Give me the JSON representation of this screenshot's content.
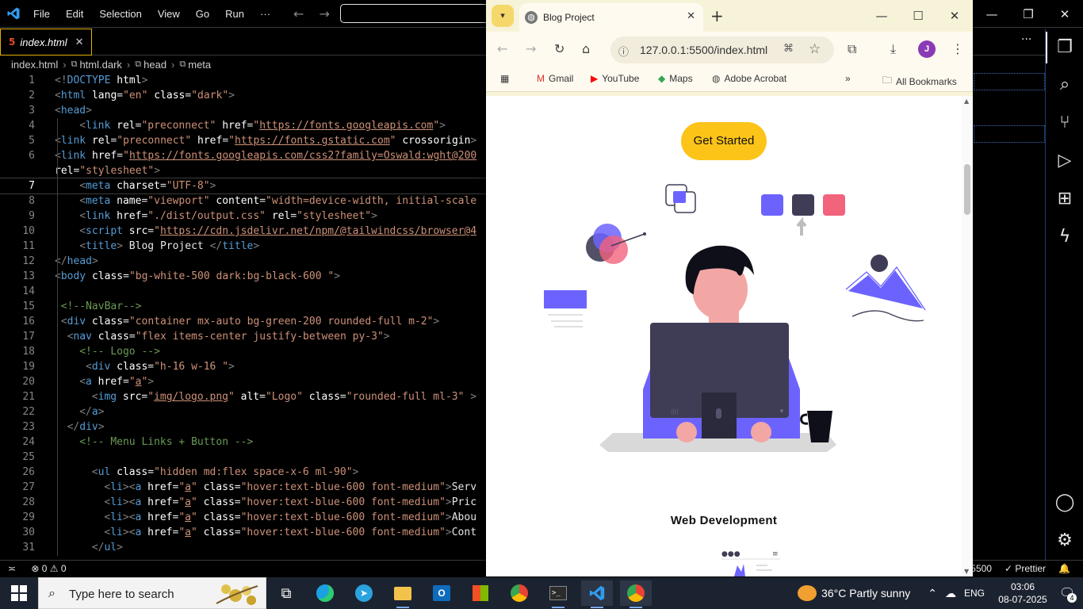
{
  "vscode": {
    "menu": [
      "File",
      "Edit",
      "Selection",
      "View",
      "Go",
      "Run",
      "···"
    ],
    "tab": {
      "label": "index.html",
      "close": "✕"
    },
    "more_actions": "···",
    "breadcrumb": [
      "index.html",
      "html.dark",
      "head",
      "meta"
    ],
    "active_line": 7,
    "lines": [
      {
        "n": "1",
        "indent": 0,
        "parts": [
          [
            "c-tag",
            "<!"
          ],
          [
            "c-name",
            "DOCTYPE"
          ],
          [
            "c-attr",
            " html"
          ],
          [
            "c-tag",
            ">"
          ]
        ]
      },
      {
        "n": "2",
        "indent": 0,
        "parts": [
          [
            "c-tag",
            "<"
          ],
          [
            "c-name",
            "html"
          ],
          [
            "c-attr",
            " lang"
          ],
          [
            "",
            "="
          ],
          [
            "c-str",
            "\"en\""
          ],
          [
            "c-attr",
            " class"
          ],
          [
            "",
            "="
          ],
          [
            "c-str",
            "\"dark\""
          ],
          [
            "c-tag",
            ">"
          ]
        ]
      },
      {
        "n": "3",
        "indent": 0,
        "parts": [
          [
            "c-tag",
            "<"
          ],
          [
            "c-name",
            "head"
          ],
          [
            "c-tag",
            ">"
          ]
        ]
      },
      {
        "n": "4",
        "indent": 4,
        "parts": [
          [
            "c-tag",
            "<"
          ],
          [
            "c-name",
            "link"
          ],
          [
            "c-attr",
            " rel"
          ],
          [
            "",
            "="
          ],
          [
            "c-str",
            "\"preconnect\""
          ],
          [
            "c-attr",
            " href"
          ],
          [
            "",
            "="
          ],
          [
            "c-str",
            "\""
          ],
          [
            "c-url",
            "https://fonts.googleapis.com"
          ],
          [
            "c-str",
            "\""
          ],
          [
            "c-tag",
            ">"
          ]
        ]
      },
      {
        "n": "5",
        "indent": 0,
        "parts": [
          [
            "c-tag",
            "<"
          ],
          [
            "c-name",
            "link"
          ],
          [
            "c-attr",
            " rel"
          ],
          [
            "",
            "="
          ],
          [
            "c-str",
            "\"preconnect\""
          ],
          [
            "c-attr",
            " href"
          ],
          [
            "",
            "="
          ],
          [
            "c-str",
            "\""
          ],
          [
            "c-url",
            "https://fonts.gstatic.com"
          ],
          [
            "c-str",
            "\""
          ],
          [
            "c-attr",
            " crossorigin"
          ],
          [
            "c-tag",
            ">"
          ]
        ]
      },
      {
        "n": "6",
        "indent": 0,
        "parts": [
          [
            "c-tag",
            "<"
          ],
          [
            "c-name",
            "link"
          ],
          [
            "c-attr",
            " href"
          ],
          [
            "",
            "="
          ],
          [
            "c-str",
            "\""
          ],
          [
            "c-url",
            "https://fonts.googleapis.com/css2?family=Oswald:wght@200"
          ]
        ]
      },
      {
        "n": "",
        "indent": 0,
        "parts": [
          [
            "c-attr",
            "rel"
          ],
          [
            "",
            "="
          ],
          [
            "c-str",
            "\"stylesheet\""
          ],
          [
            "c-tag",
            ">"
          ]
        ]
      },
      {
        "n": "7",
        "indent": 4,
        "parts": [
          [
            "c-tag",
            "<"
          ],
          [
            "c-name",
            "meta"
          ],
          [
            "c-attr",
            " charset"
          ],
          [
            "",
            "="
          ],
          [
            "c-str",
            "\"UTF-8\""
          ],
          [
            "c-tag",
            ">"
          ]
        ]
      },
      {
        "n": "8",
        "indent": 4,
        "parts": [
          [
            "c-tag",
            "<"
          ],
          [
            "c-name",
            "meta"
          ],
          [
            "c-attr",
            " name"
          ],
          [
            "",
            "="
          ],
          [
            "c-str",
            "\"viewport\""
          ],
          [
            "c-attr",
            " content"
          ],
          [
            "",
            "="
          ],
          [
            "c-str",
            "\"width=device-width, initial-scale"
          ]
        ]
      },
      {
        "n": "9",
        "indent": 4,
        "parts": [
          [
            "c-tag",
            "<"
          ],
          [
            "c-name",
            "link"
          ],
          [
            "c-attr",
            " href"
          ],
          [
            "",
            "="
          ],
          [
            "c-str",
            "\"./dist/output.css\""
          ],
          [
            "c-attr",
            " rel"
          ],
          [
            "",
            "="
          ],
          [
            "c-str",
            "\"stylesheet\""
          ],
          [
            "c-tag",
            ">"
          ]
        ]
      },
      {
        "n": "10",
        "indent": 4,
        "parts": [
          [
            "c-tag",
            "<"
          ],
          [
            "c-name",
            "script"
          ],
          [
            "c-attr",
            " src"
          ],
          [
            "",
            "="
          ],
          [
            "c-str",
            "\""
          ],
          [
            "c-url",
            "https://cdn.jsdelivr.net/npm/@tailwindcss/browser@4"
          ]
        ]
      },
      {
        "n": "11",
        "indent": 4,
        "parts": [
          [
            "c-tag",
            "<"
          ],
          [
            "c-name",
            "title"
          ],
          [
            "c-tag",
            ">"
          ],
          [
            "",
            " Blog Project "
          ],
          [
            "c-tag",
            "</"
          ],
          [
            "c-name",
            "title"
          ],
          [
            "c-tag",
            ">"
          ]
        ]
      },
      {
        "n": "12",
        "indent": 0,
        "parts": [
          [
            "c-tag",
            "</"
          ],
          [
            "c-name",
            "head"
          ],
          [
            "c-tag",
            ">"
          ]
        ]
      },
      {
        "n": "13",
        "indent": 0,
        "parts": [
          [
            "c-tag",
            "<"
          ],
          [
            "c-name",
            "body"
          ],
          [
            "c-attr",
            " class"
          ],
          [
            "",
            "="
          ],
          [
            "c-str",
            "\"bg-white-500 dark:bg-black-600 \""
          ],
          [
            "c-tag",
            ">"
          ]
        ]
      },
      {
        "n": "14",
        "indent": 0,
        "parts": []
      },
      {
        "n": "15",
        "indent": 1,
        "parts": [
          [
            "c-com",
            "<!--NavBar-->"
          ]
        ]
      },
      {
        "n": "16",
        "indent": 1,
        "parts": [
          [
            "c-tag",
            "<"
          ],
          [
            "c-name",
            "div"
          ],
          [
            "c-attr",
            " class"
          ],
          [
            "",
            "="
          ],
          [
            "c-str",
            "\"container mx-auto bg-green-200 rounded-full m-2\""
          ],
          [
            "c-tag",
            ">"
          ]
        ]
      },
      {
        "n": "17",
        "indent": 2,
        "parts": [
          [
            "c-tag",
            "<"
          ],
          [
            "c-name",
            "nav"
          ],
          [
            "c-attr",
            " class"
          ],
          [
            "",
            "="
          ],
          [
            "c-str",
            "\"flex items-center justify-between py-3\""
          ],
          [
            "c-tag",
            ">"
          ]
        ]
      },
      {
        "n": "18",
        "indent": 4,
        "parts": [
          [
            "c-com",
            "<!-- Logo -->"
          ]
        ]
      },
      {
        "n": "19",
        "indent": 5,
        "parts": [
          [
            "c-tag",
            "<"
          ],
          [
            "c-name",
            "div"
          ],
          [
            "c-attr",
            " class"
          ],
          [
            "",
            "="
          ],
          [
            "c-str",
            "\"h-16 w-16 \""
          ],
          [
            "c-tag",
            ">"
          ]
        ]
      },
      {
        "n": "20",
        "indent": 4,
        "parts": [
          [
            "c-tag",
            "<"
          ],
          [
            "c-name",
            "a"
          ],
          [
            "c-attr",
            " href"
          ],
          [
            "",
            "="
          ],
          [
            "c-str",
            "\""
          ],
          [
            "c-url",
            "a"
          ],
          [
            "c-str",
            "\""
          ],
          [
            "c-tag",
            ">"
          ]
        ]
      },
      {
        "n": "21",
        "indent": 6,
        "parts": [
          [
            "c-tag",
            "<"
          ],
          [
            "c-name",
            "img"
          ],
          [
            "c-attr",
            " src"
          ],
          [
            "",
            "="
          ],
          [
            "c-str",
            "\""
          ],
          [
            "c-url",
            "img/logo.png"
          ],
          [
            "c-str",
            "\""
          ],
          [
            "c-attr",
            " alt"
          ],
          [
            "",
            "="
          ],
          [
            "c-str",
            "\"Logo\""
          ],
          [
            "c-attr",
            " class"
          ],
          [
            "",
            "="
          ],
          [
            "c-str",
            "\"rounded-full ml-3\""
          ],
          [
            "c-tag",
            " >"
          ]
        ]
      },
      {
        "n": "22",
        "indent": 4,
        "parts": [
          [
            "c-tag",
            "</"
          ],
          [
            "c-name",
            "a"
          ],
          [
            "c-tag",
            ">"
          ]
        ]
      },
      {
        "n": "23",
        "indent": 2,
        "parts": [
          [
            "c-tag",
            "</"
          ],
          [
            "c-name",
            "div"
          ],
          [
            "c-tag",
            ">"
          ]
        ]
      },
      {
        "n": "24",
        "indent": 4,
        "parts": [
          [
            "c-com",
            "<!-- Menu Links + Button -->"
          ]
        ]
      },
      {
        "n": "25",
        "indent": 0,
        "parts": []
      },
      {
        "n": "26",
        "indent": 6,
        "parts": [
          [
            "c-tag",
            "<"
          ],
          [
            "c-name",
            "ul"
          ],
          [
            "c-attr",
            " class"
          ],
          [
            "",
            "="
          ],
          [
            "c-str",
            "\"hidden md:flex space-x-6 ml-90\""
          ],
          [
            "c-tag",
            ">"
          ]
        ]
      },
      {
        "n": "27",
        "indent": 8,
        "parts": [
          [
            "c-tag",
            "<"
          ],
          [
            "c-name",
            "li"
          ],
          [
            "c-tag",
            ">"
          ],
          [
            "c-tag",
            "<"
          ],
          [
            "c-name",
            "a"
          ],
          [
            "c-attr",
            " href"
          ],
          [
            "",
            "="
          ],
          [
            "c-str",
            "\""
          ],
          [
            "c-url",
            "a"
          ],
          [
            "c-str",
            "\""
          ],
          [
            "c-attr",
            " class"
          ],
          [
            "",
            "="
          ],
          [
            "c-str",
            "\"hover:text-blue-600 font-medium\""
          ],
          [
            "c-tag",
            ">"
          ],
          [
            "",
            "Serv"
          ]
        ]
      },
      {
        "n": "28",
        "indent": 8,
        "parts": [
          [
            "c-tag",
            "<"
          ],
          [
            "c-name",
            "li"
          ],
          [
            "c-tag",
            ">"
          ],
          [
            "c-tag",
            "<"
          ],
          [
            "c-name",
            "a"
          ],
          [
            "c-attr",
            " href"
          ],
          [
            "",
            "="
          ],
          [
            "c-str",
            "\""
          ],
          [
            "c-url",
            "a"
          ],
          [
            "c-str",
            "\""
          ],
          [
            "c-attr",
            " class"
          ],
          [
            "",
            "="
          ],
          [
            "c-str",
            "\"hover:text-blue-600 font-medium\""
          ],
          [
            "c-tag",
            ">"
          ],
          [
            "",
            "Pric"
          ]
        ]
      },
      {
        "n": "29",
        "indent": 8,
        "parts": [
          [
            "c-tag",
            "<"
          ],
          [
            "c-name",
            "li"
          ],
          [
            "c-tag",
            ">"
          ],
          [
            "c-tag",
            "<"
          ],
          [
            "c-name",
            "a"
          ],
          [
            "c-attr",
            " href"
          ],
          [
            "",
            "="
          ],
          [
            "c-str",
            "\""
          ],
          [
            "c-url",
            "a"
          ],
          [
            "c-str",
            "\""
          ],
          [
            "c-attr",
            " class"
          ],
          [
            "",
            "="
          ],
          [
            "c-str",
            "\"hover:text-blue-600 font-medium\""
          ],
          [
            "c-tag",
            ">"
          ],
          [
            "",
            "Abou"
          ]
        ]
      },
      {
        "n": "30",
        "indent": 8,
        "parts": [
          [
            "c-tag",
            "<"
          ],
          [
            "c-name",
            "li"
          ],
          [
            "c-tag",
            ">"
          ],
          [
            "c-tag",
            "<"
          ],
          [
            "c-name",
            "a"
          ],
          [
            "c-attr",
            " href"
          ],
          [
            "",
            "="
          ],
          [
            "c-str",
            "\""
          ],
          [
            "c-url",
            "a"
          ],
          [
            "c-str",
            "\""
          ],
          [
            "c-attr",
            " class"
          ],
          [
            "",
            "="
          ],
          [
            "c-str",
            "\"hover:text-blue-600 font-medium\""
          ],
          [
            "c-tag",
            ">"
          ],
          [
            "",
            "Cont"
          ]
        ]
      },
      {
        "n": "31",
        "indent": 6,
        "parts": [
          [
            "c-tag",
            "</"
          ],
          [
            "c-name",
            "ul"
          ],
          [
            "c-tag",
            ">"
          ]
        ]
      }
    ],
    "status": {
      "remote_icon": "≍",
      "problems": "⊗ 0 ⚠ 0",
      "port": "5500",
      "prettier": "✓ Prettier",
      "bell": "🔔"
    }
  },
  "browser": {
    "tab_title": "Blog Project",
    "url": "127.0.0.1:5500/index.html",
    "avatar_letter": "J",
    "bookmarks": [
      "Gmail",
      "YouTube",
      "Maps",
      "Adobe Acrobat"
    ],
    "all_bookmarks": "All Bookmarks",
    "overflow": "»",
    "cta_label": "Get Started",
    "section_title": "Web Development"
  },
  "taskbar": {
    "search_placeholder": "Type here to search",
    "weather": "36°C  Partly sunny",
    "language": "ENG",
    "time": "03:06",
    "date": "08-07-2025",
    "notifications": "4"
  }
}
